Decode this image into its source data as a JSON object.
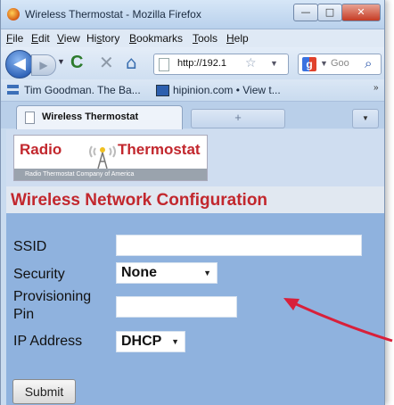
{
  "window": {
    "title": "Wireless Thermostat - Mozilla Firefox",
    "controls": {
      "minimize": "—",
      "maximize": "□",
      "close": "✕"
    }
  },
  "menubar": {
    "items": [
      {
        "accel": "F",
        "rest": "ile"
      },
      {
        "accel": "E",
        "rest": "dit"
      },
      {
        "accel": "V",
        "rest": "iew"
      },
      {
        "pre": "Hi",
        "accel": "s",
        "rest": "tory"
      },
      {
        "accel": "B",
        "rest": "ookmarks"
      },
      {
        "accel": "T",
        "rest": "ools"
      },
      {
        "accel": "H",
        "rest": "elp"
      }
    ]
  },
  "navbar": {
    "url": "http://192.1",
    "search_placeholder": "Goo"
  },
  "icons": {
    "back": "back-arrow-icon",
    "reload": "reload-icon",
    "stop": "stop-icon",
    "home": "home-icon",
    "bookmark_star": "star-icon",
    "search": "magnifier-icon"
  },
  "bookmarks": {
    "items": [
      {
        "label": "Tim Goodman. The Ba..."
      },
      {
        "label": "hipinion.com • View t..."
      }
    ],
    "overflow": "»"
  },
  "tabs": {
    "active_label": "Wireless Thermostat",
    "new_tab": "+",
    "tab_list": "▼"
  },
  "logo": {
    "word_left": "Radio",
    "word_right": "Thermostat",
    "tagline": "Radio Thermostat Company of America"
  },
  "page": {
    "heading": "Wireless Network Configuration",
    "ssid_label": "SSID",
    "ssid_value": "",
    "security_label": "Security",
    "security_value": "None",
    "pin_label_line1": "Provisioning",
    "pin_label_line2": "Pin",
    "pin_value": "",
    "ip_label": "IP Address",
    "ip_value": "DHCP",
    "submit_label": "Submit"
  },
  "colors": {
    "brand_red": "#c2272d",
    "page_blue": "#8fb2de",
    "annotation_arrow": "#d8203a"
  }
}
